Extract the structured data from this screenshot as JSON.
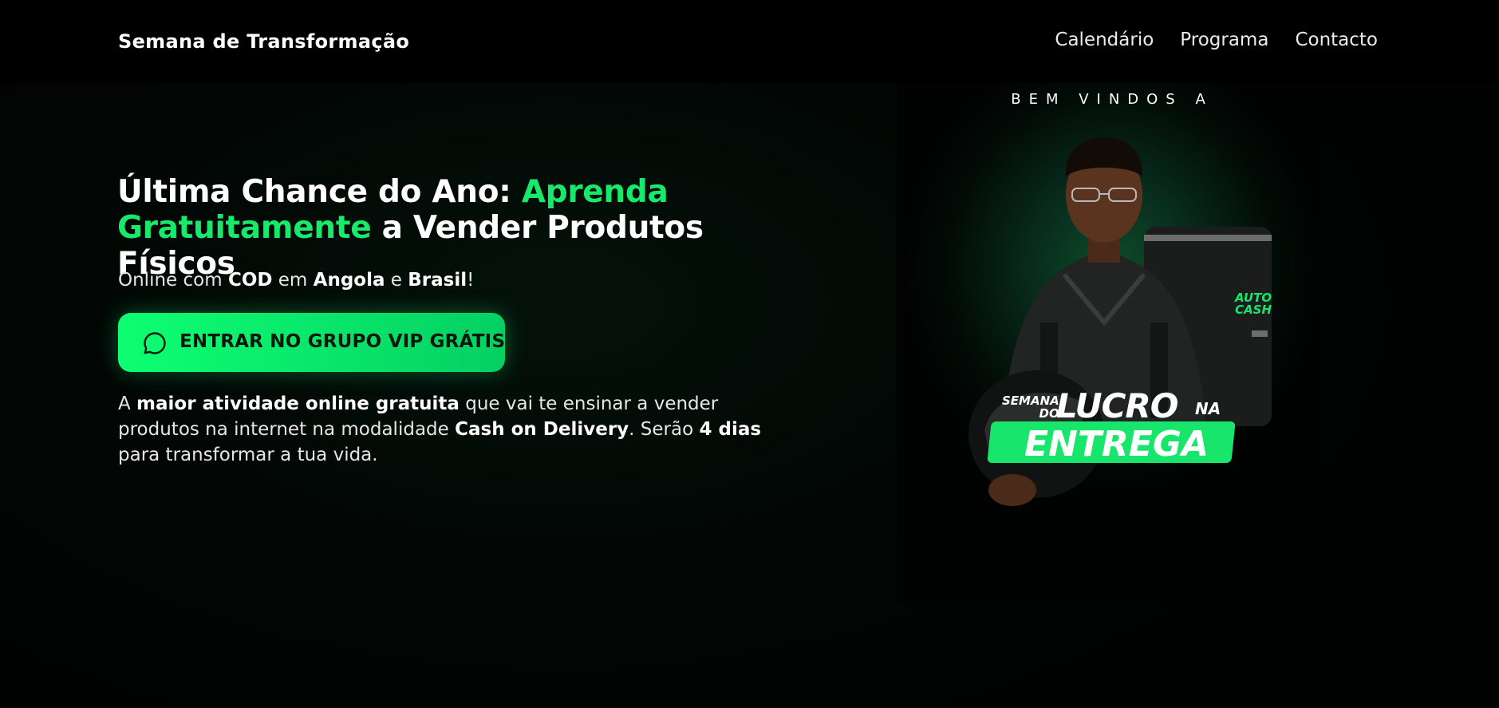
{
  "header": {
    "brand": "Semana de Transformação",
    "nav": [
      {
        "label": "Calendário"
      },
      {
        "label": "Programa"
      },
      {
        "label": "Contacto"
      }
    ]
  },
  "hero": {
    "headline_part1": "Última Chance do Ano: ",
    "headline_highlight": "Aprenda Gratuitamente",
    "headline_part2": " a Vender Produtos Físicos",
    "subline": {
      "t1": "Online com ",
      "b1": "COD",
      "t2": " em ",
      "b2": "Angola",
      "t3": " e ",
      "b3": "Brasil",
      "t4": "!"
    },
    "cta_label": "ENTRAR NO GRUPO VIP GRÁTIS",
    "cta_icon": "whatsapp-chat-icon",
    "description": {
      "t1": "A ",
      "b1": "maior atividade online gratuita",
      "t2": " que vai te ensinar a vender produtos na internet na modalidade ",
      "b2": "Cash on Delivery",
      "t3": ". Serão ",
      "b3": "4 dias",
      "t4": " para transformar a tua vida."
    }
  },
  "promo": {
    "welcome": "BEM VINDOS A",
    "small_top": "SEMANA",
    "small_bottom": "DO",
    "big": "LUCRO",
    "na": "NA",
    "banner": "ENTREGA",
    "bag_brand_top": "AUTO",
    "bag_brand_bottom": "CASH"
  },
  "colors": {
    "accent": "#17ea6a",
    "background": "#010302",
    "cta_text": "#06180c"
  }
}
